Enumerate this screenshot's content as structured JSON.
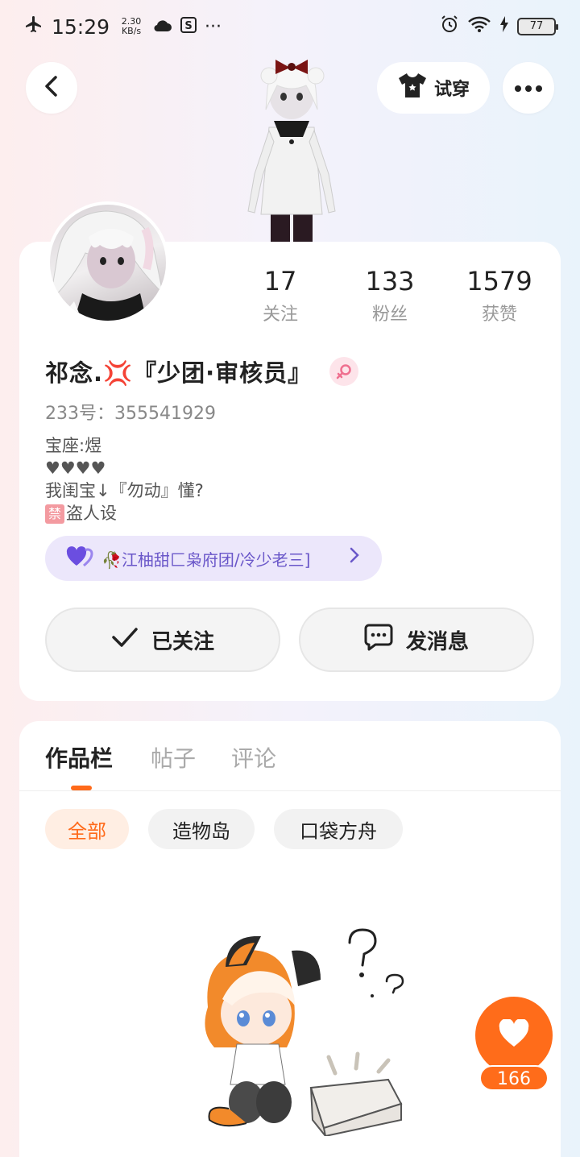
{
  "status_bar": {
    "time": "15:29",
    "net_speed_value": "2.30",
    "net_speed_unit": "KB/s",
    "battery": "77"
  },
  "header": {
    "try_on_label": "试穿"
  },
  "profile": {
    "name": "祁念.💢『少团·审核员』",
    "uid": "233号：355541929",
    "bio": {
      "line1": "宝座:煜",
      "line2": "♥♥♥♥",
      "line3": "我闺宝↓『勿动』懂?",
      "line4_badge": "禁",
      "line4_text": "盗人设"
    },
    "group_label": "🥀江柚甜匚枭府团/冷少老三]",
    "stats": [
      {
        "num": "17",
        "label": "关注"
      },
      {
        "num": "133",
        "label": "粉丝"
      },
      {
        "num": "1579",
        "label": "获赞"
      }
    ],
    "followed_label": "已关注",
    "message_label": "发消息"
  },
  "tabs": [
    {
      "label": "作品栏",
      "active": true
    },
    {
      "label": "帖子",
      "active": false
    },
    {
      "label": "评论",
      "active": false
    }
  ],
  "filters": [
    {
      "label": "全部",
      "active": true
    },
    {
      "label": "造物岛",
      "active": false
    },
    {
      "label": "口袋方舟",
      "active": false
    }
  ],
  "like_fab": {
    "count": "166"
  },
  "colors": {
    "accent": "#ff6a1a",
    "group_pill_bg": "#ece7fb",
    "group_pill_text": "#6a57c9"
  },
  "icons": [
    "airplane-icon",
    "cloud-icon",
    "sync-icon",
    "alarm-icon",
    "wifi-icon",
    "charging-icon",
    "back-icon",
    "shirt-icon",
    "more-icon",
    "female-icon",
    "heart-icon",
    "check-icon",
    "chat-icon",
    "chevron-right-icon"
  ]
}
